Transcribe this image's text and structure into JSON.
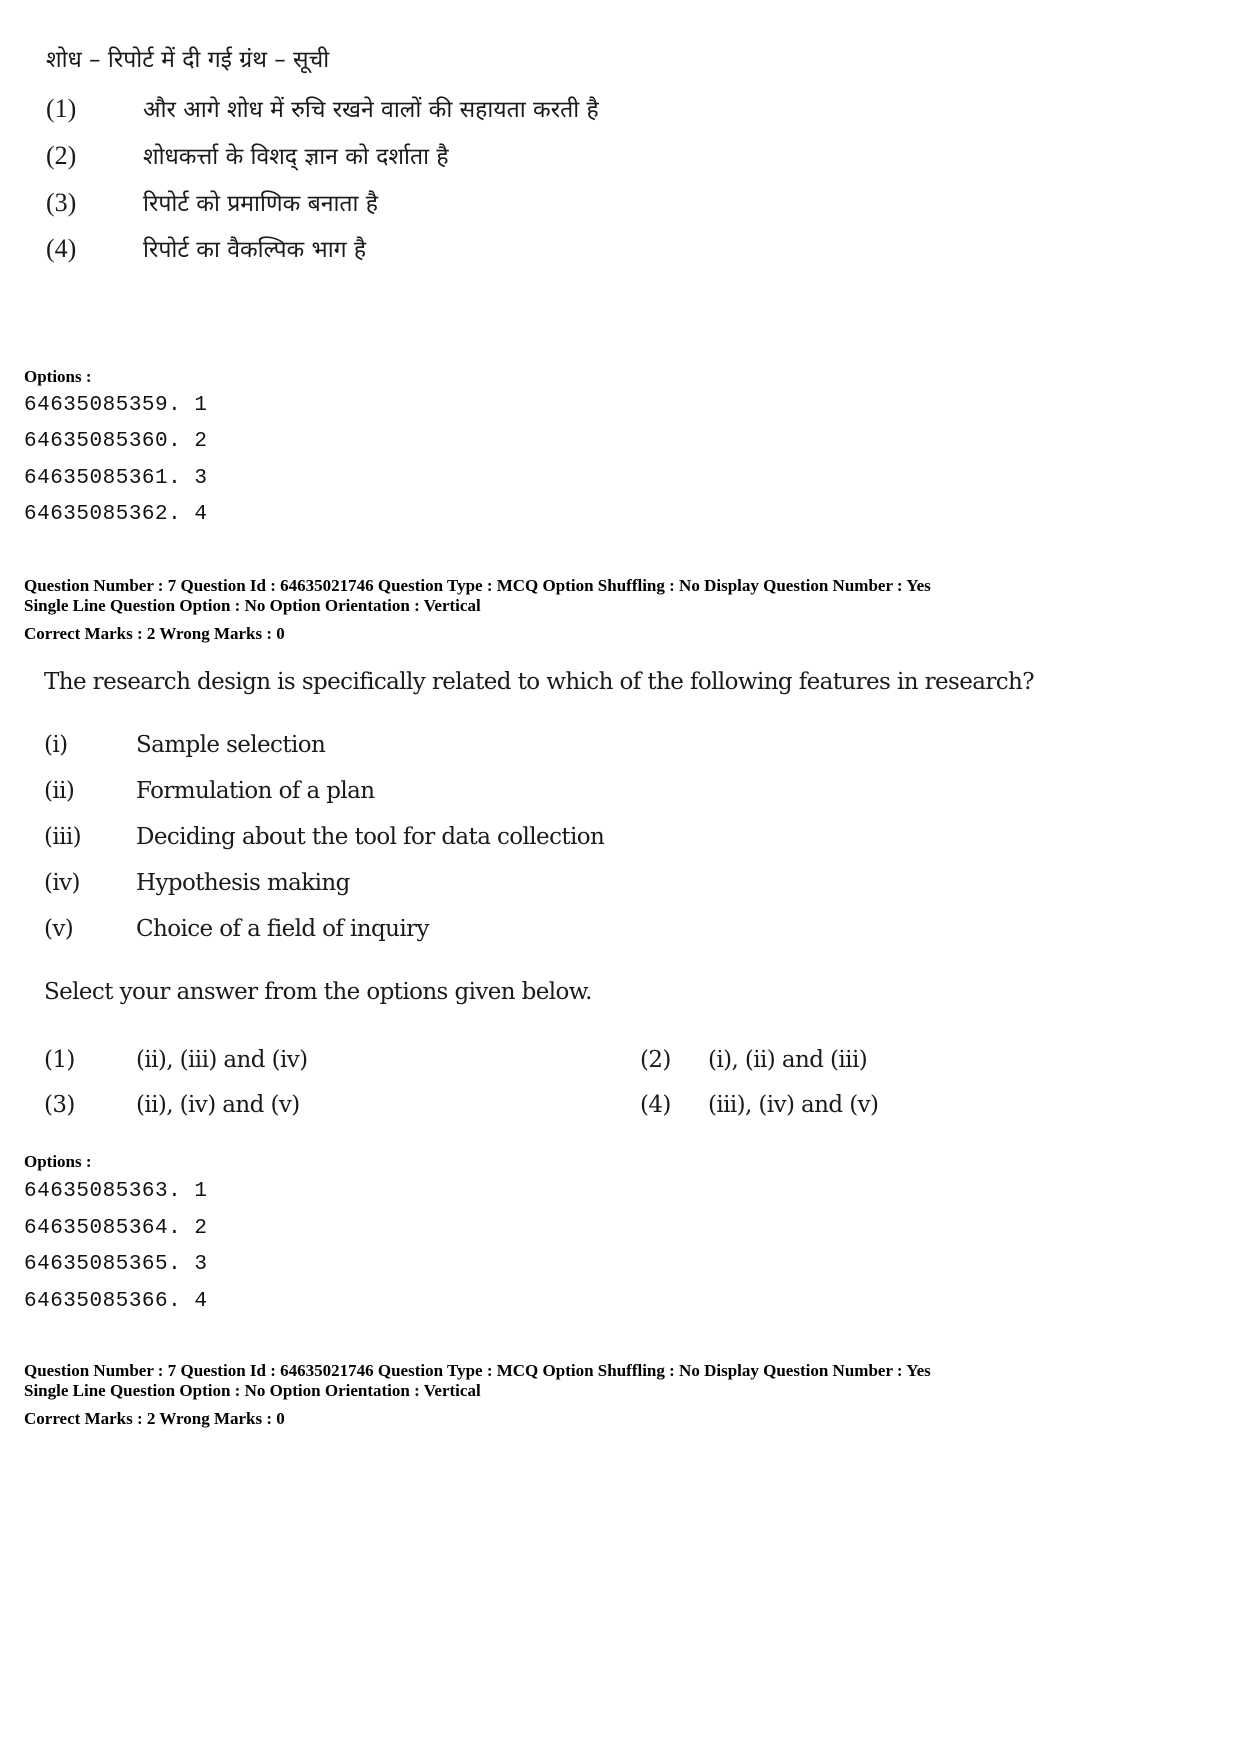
{
  "previous_question": {
    "stem": "शोध – रिपोर्ट में दी गई ग्रंथ – सूची",
    "items": [
      {
        "num": "(1)",
        "text": "और आगे शोध में रुचि रखने वालों की सहायता करती है"
      },
      {
        "num": "(2)",
        "text": "शोधकर्त्ता के विशद् ज्ञान को दर्शाता है"
      },
      {
        "num": "(3)",
        "text": "रिपोर्ट को प्रमाणिक बनाता है"
      },
      {
        "num": "(4)",
        "text": "रिपोर्ट का वैकल्पिक भाग है"
      }
    ],
    "options_label": "Options :",
    "options": [
      "64635085359. 1",
      "64635085360. 2",
      "64635085361. 3",
      "64635085362. 4"
    ]
  },
  "question_7": {
    "meta": {
      "line1": "Question Number : 7  Question Id : 64635021746  Question Type : MCQ  Option Shuffling : No  Display Question Number : Yes",
      "line2": "Single Line Question Option : No  Option Orientation : Vertical",
      "marks": "Correct Marks : 2  Wrong Marks : 0"
    },
    "stem": "The research design is specifically related to which of the following features in research?",
    "items": [
      {
        "num": "(i)",
        "text": "Sample selection"
      },
      {
        "num": "(ii)",
        "text": "Formulation of a plan"
      },
      {
        "num": "(iii)",
        "text": "Deciding about the tool for data collection"
      },
      {
        "num": "(iv)",
        "text": "Hypothesis making"
      },
      {
        "num": "(v)",
        "text": "Choice of a field of inquiry"
      }
    ],
    "select_text": "Select your answer from the options given below.",
    "answers": [
      {
        "num": "(1)",
        "text": "(ii), (iii) and (iv)"
      },
      {
        "num": "(2)",
        "text": "(i), (ii) and (iii)"
      },
      {
        "num": "(3)",
        "text": "(ii), (iv) and (v)"
      },
      {
        "num": "(4)",
        "text": "(iii), (iv) and (v)"
      }
    ],
    "options_label": "Options :",
    "options": [
      "64635085363. 1",
      "64635085364. 2",
      "64635085365. 3",
      "64635085366. 4"
    ]
  },
  "next_question": {
    "meta": {
      "line1": "Question Number : 7  Question Id : 64635021746  Question Type : MCQ  Option Shuffling : No  Display Question Number : Yes",
      "line2": "Single Line Question Option : No  Option Orientation : Vertical",
      "marks": "Correct Marks : 2  Wrong Marks : 0"
    }
  }
}
